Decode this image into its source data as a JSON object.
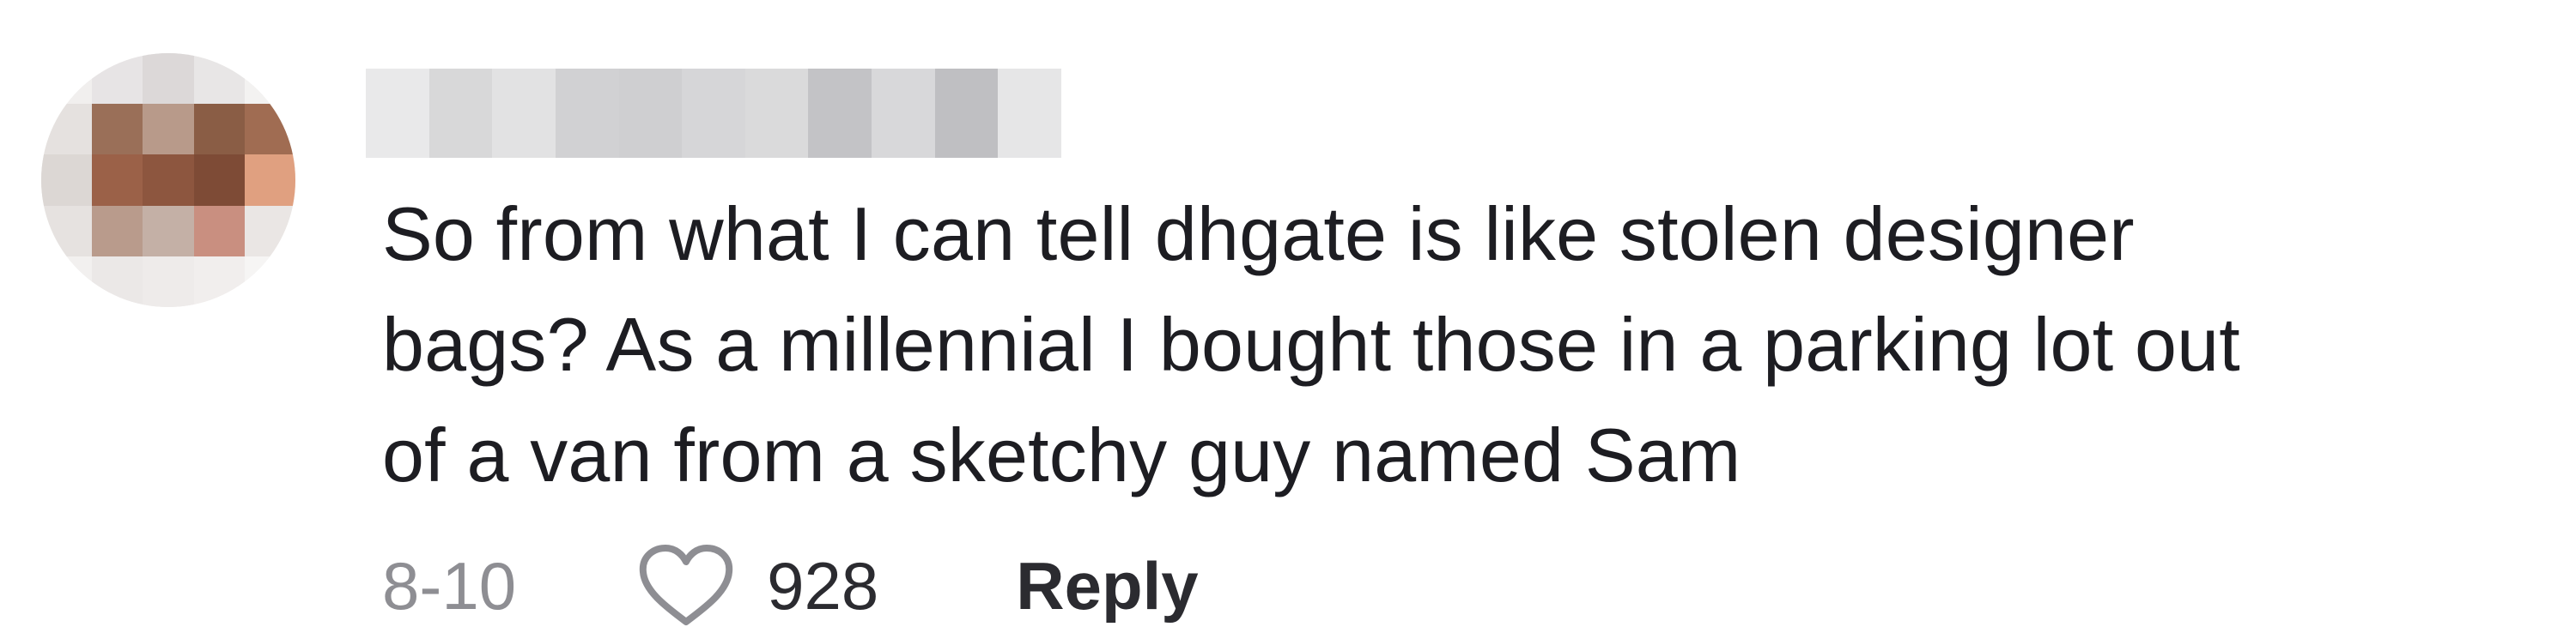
{
  "comment": {
    "text": "So from what I can tell dhgate is like stolen designer\nbags? As a millennial I bought those in a parking lot out\nof a van from a sketchy guy named Sam",
    "date": "8-10",
    "like_count": "928",
    "reply_label": "Reply",
    "heart_icon": "heart-outline-icon"
  },
  "colors": {
    "text": "#1d1d22",
    "muted": "#8e8e93",
    "heart_stroke": "#8e8e93"
  }
}
